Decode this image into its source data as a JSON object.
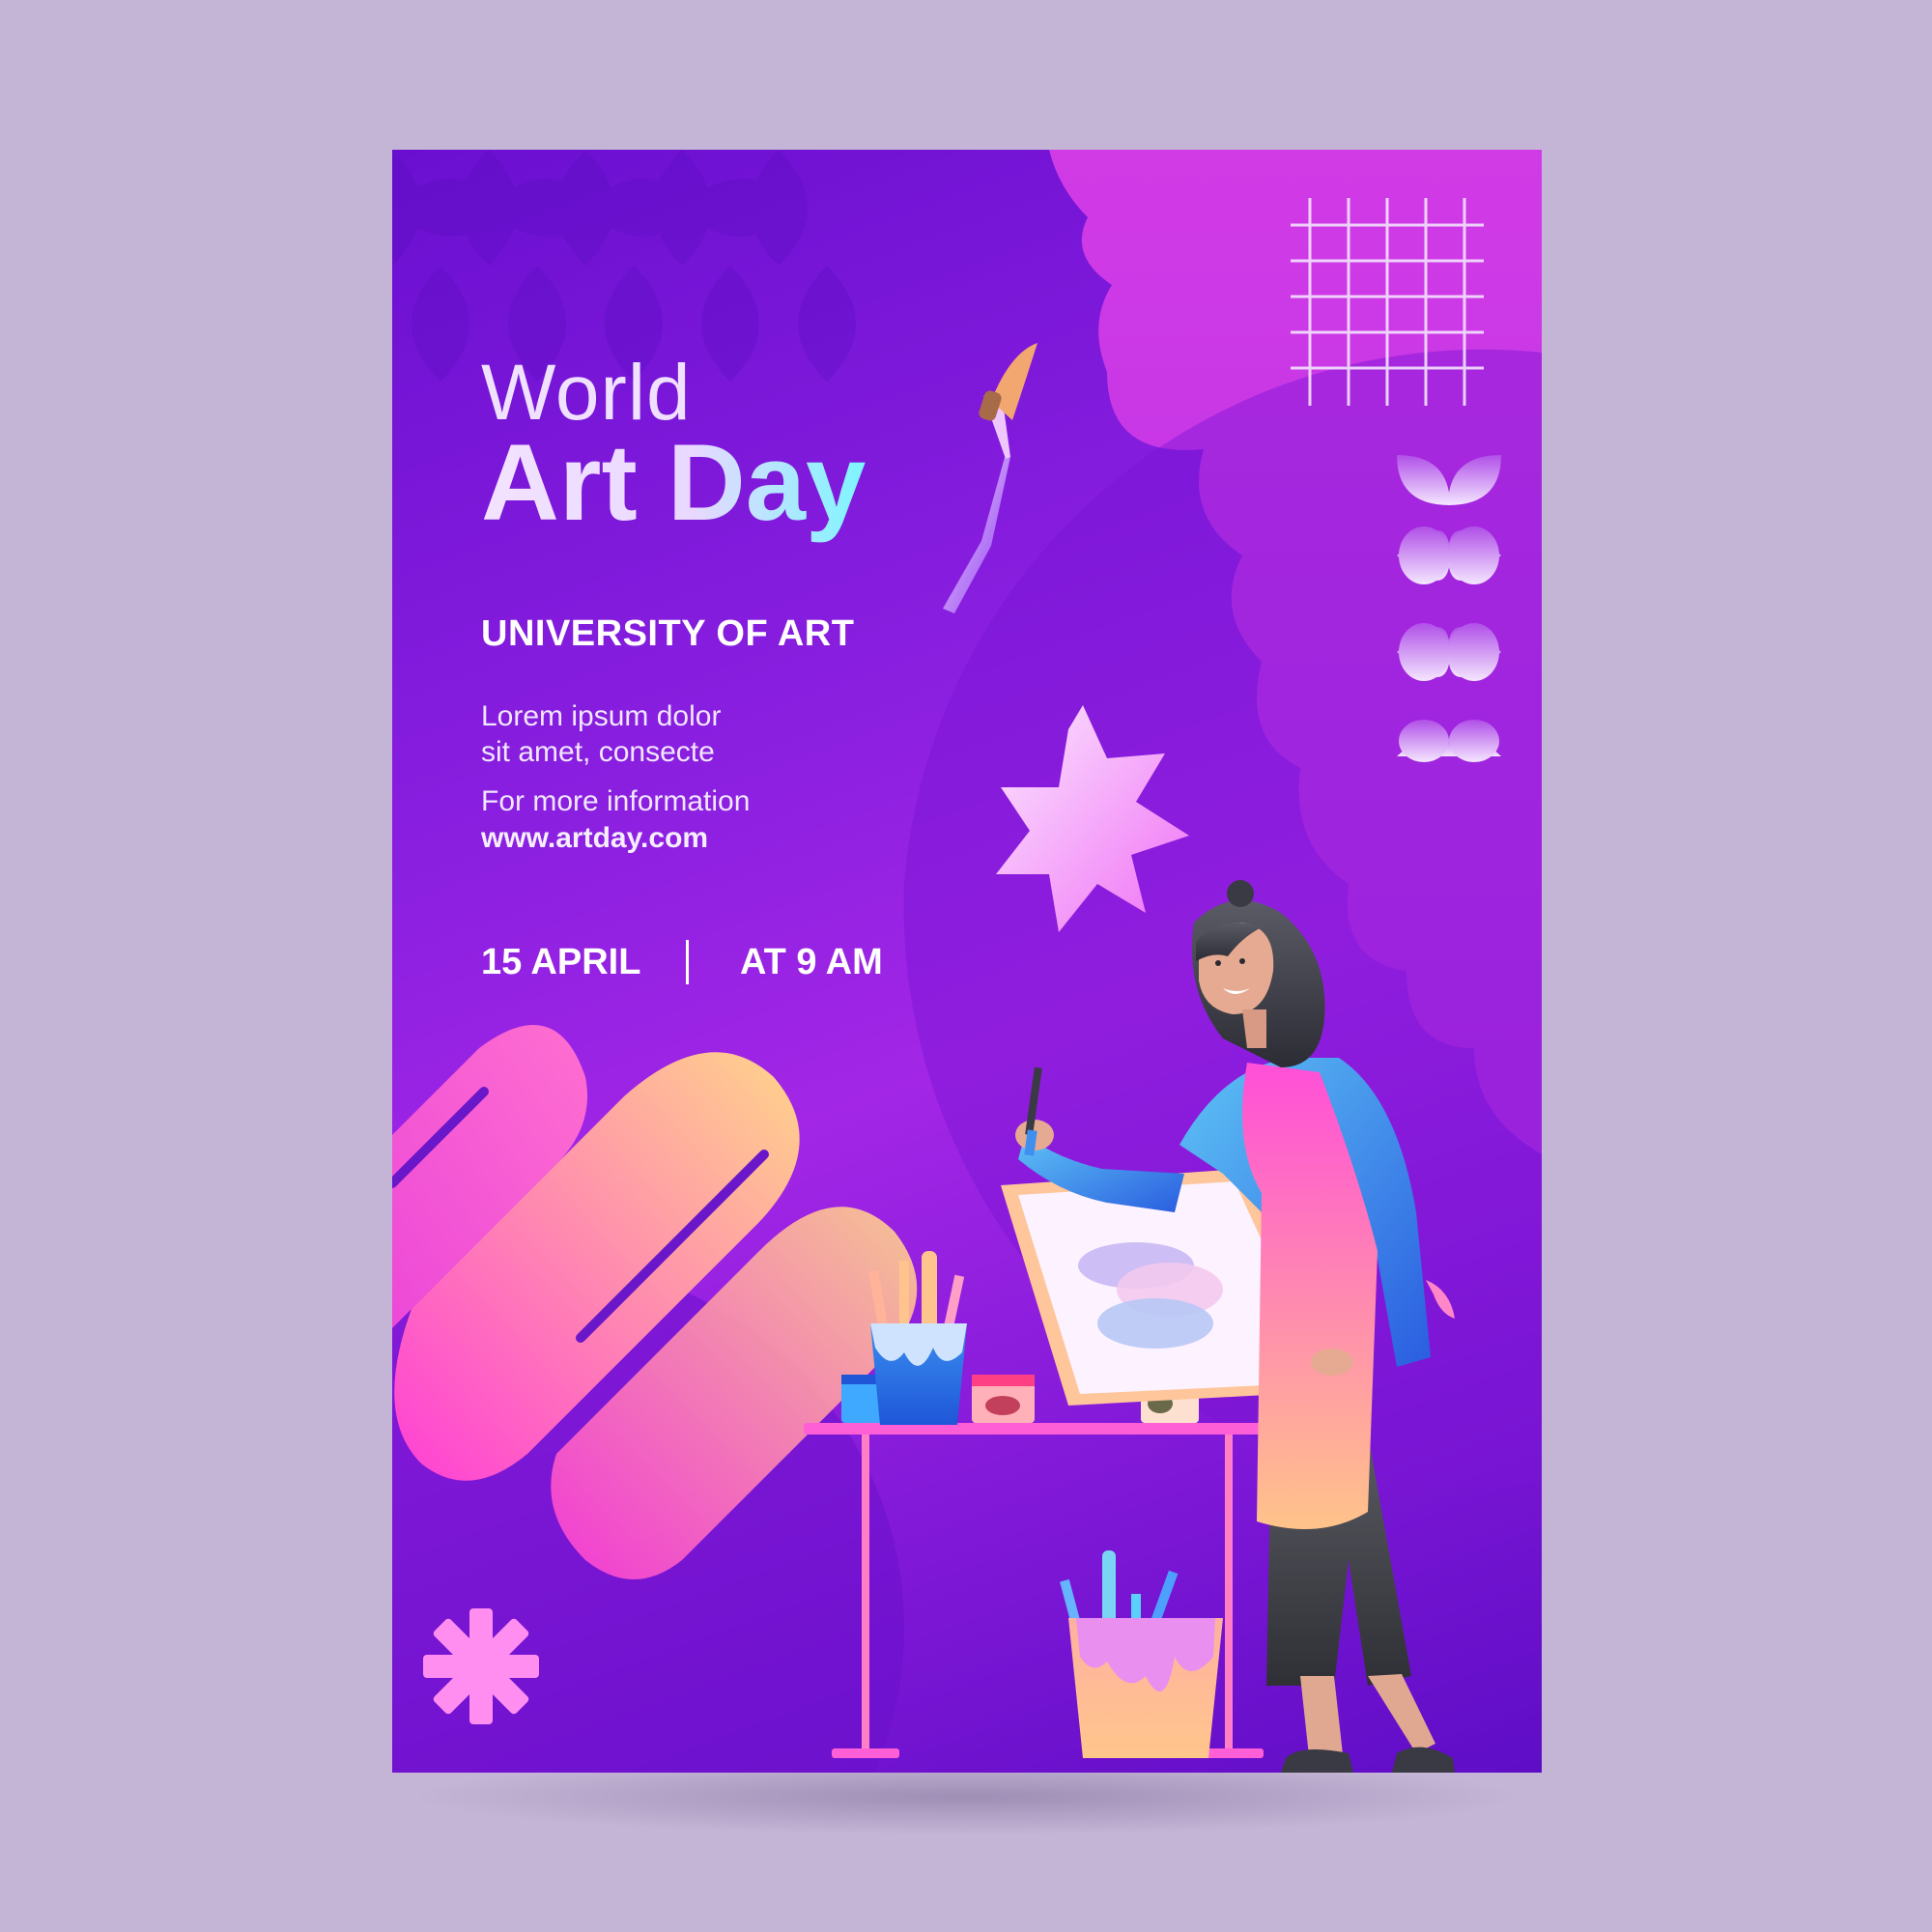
{
  "poster": {
    "title_line1": "World",
    "title_line2": "Art Day",
    "organizer": "UNIVERSITY OF ART",
    "description_line1": "Lorem ipsum dolor",
    "description_line2": "sit amet, consecte",
    "info_label": "For more information",
    "website": "www.artday.com",
    "date": "15 APRIL",
    "time": "AT 9 AM"
  },
  "icons": {
    "paintbrush": "paintbrush-icon",
    "star": "star-burst-icon",
    "asterisk": "asterisk-icon",
    "grid": "grid-decoration-icon",
    "petals": "petal-pattern-icon"
  },
  "colors": {
    "page_background": "#c4b5d6",
    "poster_primary": "#8a1fe0",
    "accent_pink": "#ff5fd0",
    "accent_peach": "#ffc98a",
    "accent_cyan": "#7cf6ff"
  }
}
